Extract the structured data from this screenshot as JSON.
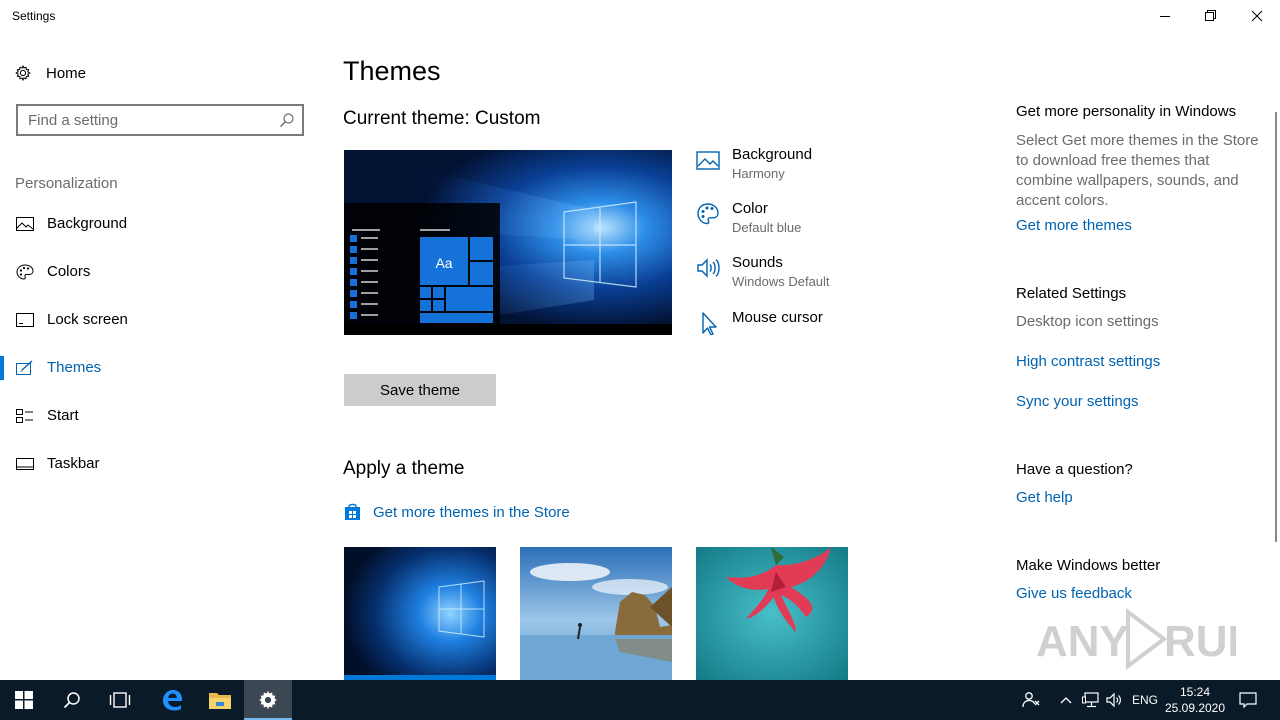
{
  "window": {
    "title": "Settings"
  },
  "sidebar": {
    "home_label": "Home",
    "search_placeholder": "Find a setting",
    "section_label": "Personalization",
    "items": [
      {
        "label": "Background",
        "icon": "image-icon"
      },
      {
        "label": "Colors",
        "icon": "palette-icon"
      },
      {
        "label": "Lock screen",
        "icon": "lock-screen-icon"
      },
      {
        "label": "Themes",
        "icon": "brush-icon",
        "active": true
      },
      {
        "label": "Start",
        "icon": "start-icon"
      },
      {
        "label": "Taskbar",
        "icon": "taskbar-icon"
      }
    ]
  },
  "main": {
    "title": "Themes",
    "current_theme_label": "Current theme:",
    "current_theme_name": "Custom",
    "preview_tile_text": "Aa",
    "properties": [
      {
        "name": "Background",
        "value": "Harmony",
        "icon": "image-icon"
      },
      {
        "name": "Color",
        "value": "Default blue",
        "icon": "palette-icon"
      },
      {
        "name": "Sounds",
        "value": "Windows Default",
        "icon": "speaker-icon"
      },
      {
        "name": "Mouse cursor",
        "value": "",
        "icon": "cursor-icon"
      }
    ],
    "save_button": "Save theme",
    "apply_heading": "Apply a theme",
    "store_link": "Get more themes in the Store",
    "themes": [
      "windows-theme",
      "beach-theme",
      "flower-theme"
    ],
    "accent_color": "#0078d7",
    "link_color": "#0063b1"
  },
  "right": {
    "personality_heading": "Get more personality in Windows",
    "personality_text": "Select Get more themes in the Store to download free themes that combine wallpapers, sounds, and accent colors.",
    "personality_link": "Get more themes",
    "related_heading": "Related Settings",
    "related_disabled": "Desktop icon settings",
    "related_links": [
      "High contrast settings",
      "Sync your settings"
    ],
    "question_heading": "Have a question?",
    "question_link": "Get help",
    "better_heading": "Make Windows better",
    "better_link": "Give us feedback"
  },
  "watermark": "ANY RUN",
  "taskbar": {
    "language": "ENG",
    "time": "15:24",
    "date": "25.09.2020",
    "color": "#0b1a28"
  }
}
